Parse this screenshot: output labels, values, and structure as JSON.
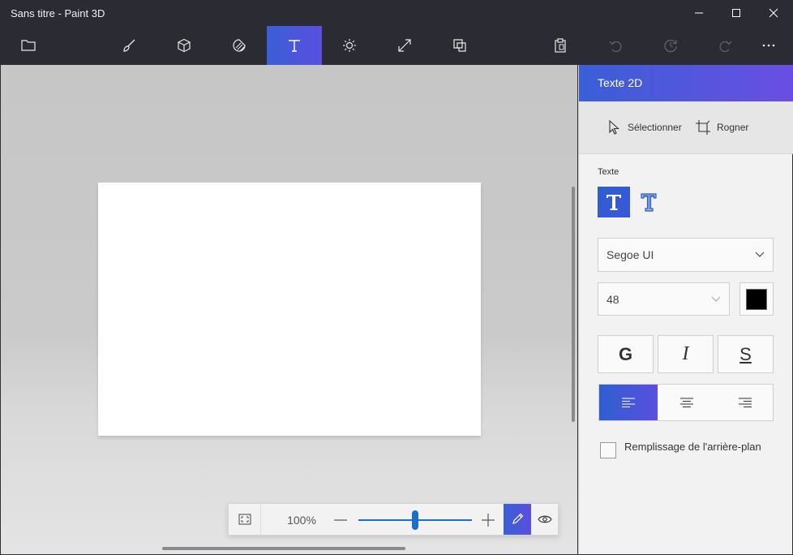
{
  "window": {
    "title": "Sans titre - Paint 3D"
  },
  "toolbar": {
    "items": [
      {
        "name": "menu",
        "icon": "folder-icon"
      },
      {
        "name": "brushes",
        "icon": "brush-icon"
      },
      {
        "name": "3d-shapes",
        "icon": "cube-icon"
      },
      {
        "name": "stickers",
        "icon": "sticker-icon"
      },
      {
        "name": "text",
        "icon": "text-icon",
        "active": true
      },
      {
        "name": "effects",
        "icon": "sun-icon"
      },
      {
        "name": "canvas",
        "icon": "resize-icon"
      },
      {
        "name": "3d-library",
        "icon": "library-icon"
      },
      {
        "name": "paste",
        "icon": "clipboard-icon"
      },
      {
        "name": "undo",
        "icon": "undo-icon"
      },
      {
        "name": "history",
        "icon": "history-icon"
      },
      {
        "name": "redo",
        "icon": "redo-icon"
      },
      {
        "name": "more",
        "icon": "more-icon"
      }
    ]
  },
  "zoom": {
    "percent": "100%",
    "slider_value": 0.5
  },
  "panel": {
    "title": "Texte 2D",
    "select_label": "Sélectionner",
    "crop_label": "Rogner",
    "text_section": "Texte",
    "font": {
      "value": "Segoe UI"
    },
    "size": {
      "value": "48"
    },
    "color": "#000000",
    "format": {
      "bold": "G",
      "italic": "I",
      "underline": "S"
    },
    "background_fill_label": "Remplissage de l'arrière-plan",
    "background_fill_checked": false
  },
  "colors": {
    "accent": "#3a5fd6",
    "accent2": "#6a4ee3",
    "chrome": "#2b2c33"
  }
}
